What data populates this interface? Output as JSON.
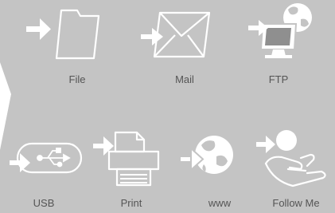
{
  "items": [
    {
      "label": "File",
      "icon": "folder-icon"
    },
    {
      "label": "Mail",
      "icon": "mail-icon"
    },
    {
      "label": "FTP",
      "icon": "ftp-icon"
    },
    {
      "label": "USB",
      "icon": "usb-icon"
    },
    {
      "label": "Print",
      "icon": "printer-icon"
    },
    {
      "label": "www",
      "icon": "globe-icon"
    },
    {
      "label": "Follow Me",
      "icon": "follow-me-icon"
    }
  ],
  "colors": {
    "background": "#c4c4c4",
    "icon": "#ffffff",
    "label": "#555555"
  }
}
